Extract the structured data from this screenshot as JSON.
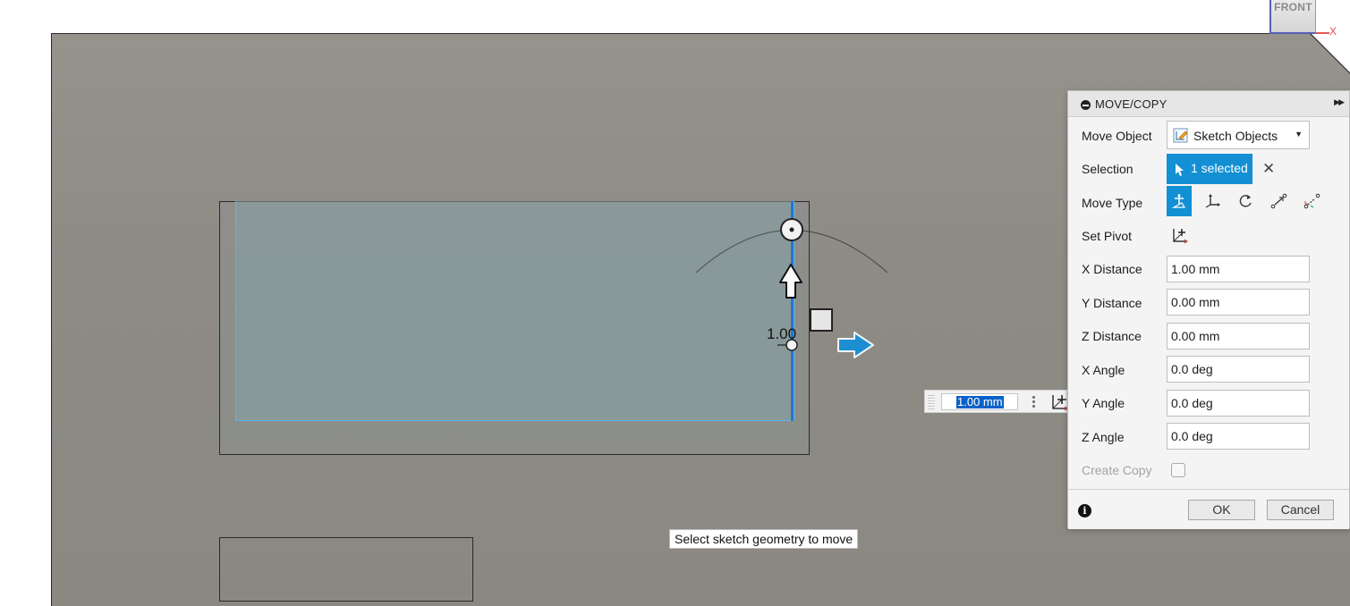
{
  "viewcube": {
    "face": "FRONT",
    "axis_label": "X"
  },
  "manipulator": {
    "distance_label": "1.00"
  },
  "inline_input": {
    "value": "1.00 mm"
  },
  "tooltip": {
    "text": "Select sketch geometry to move"
  },
  "dialog": {
    "title": "MOVE/COPY",
    "move_object": {
      "label": "Move Object",
      "value": "Sketch Objects"
    },
    "selection": {
      "label": "Selection",
      "value": "1 selected"
    },
    "move_type": {
      "label": "Move Type",
      "options": [
        "free-move",
        "translate-xyz",
        "rotate",
        "point-to-point",
        "point-to-position"
      ],
      "active": "free-move"
    },
    "set_pivot": {
      "label": "Set Pivot"
    },
    "fields": [
      {
        "label": "X Distance",
        "value": "1.00 mm"
      },
      {
        "label": "Y Distance",
        "value": "0.00 mm"
      },
      {
        "label": "Z Distance",
        "value": "0.00 mm"
      },
      {
        "label": "X Angle",
        "value": "0.0 deg"
      },
      {
        "label": "Y Angle",
        "value": "0.0 deg"
      },
      {
        "label": "Z Angle",
        "value": "0.0 deg"
      }
    ],
    "create_copy": {
      "label": "Create Copy",
      "checked": false
    },
    "ok_label": "OK",
    "cancel_label": "Cancel"
  },
  "colors": {
    "accent": "#138fd4",
    "selected_edge": "#1a78d8",
    "selection_outline": "#58b6ea",
    "viewport_bg": "#8f8c86"
  }
}
